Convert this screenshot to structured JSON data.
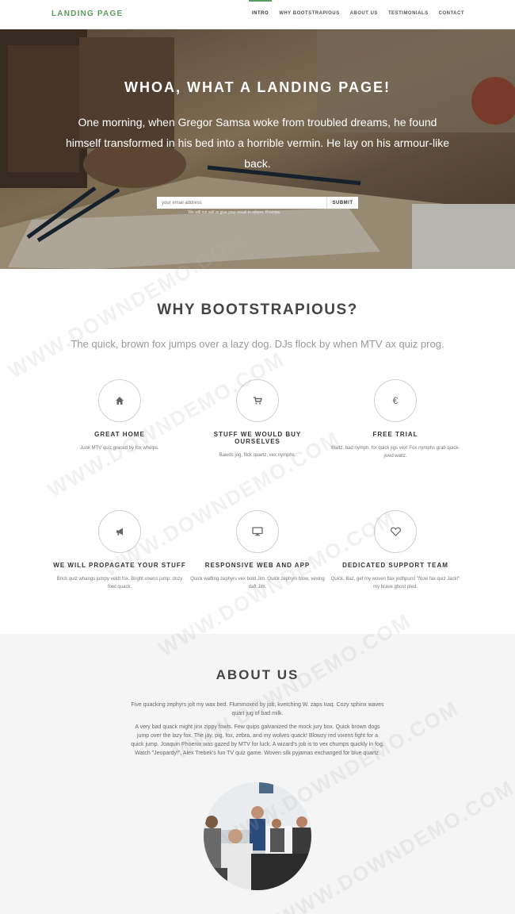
{
  "nav": {
    "brand": "LANDING PAGE",
    "items": [
      {
        "label": "INTRO",
        "active": true
      },
      {
        "label": "WHY BOOTSTRAPIOUS",
        "active": false
      },
      {
        "label": "ABOUT US",
        "active": false
      },
      {
        "label": "TESTIMONIALS",
        "active": false
      },
      {
        "label": "CONTACT",
        "active": false
      }
    ]
  },
  "hero": {
    "title": "WHOA, WHAT A LANDING PAGE!",
    "subtitle": "One morning, when Gregor Samsa woke from troubled dreams, he found himself transformed in his bed into a horrible vermin. He lay on his armour-like back.",
    "email_placeholder": "your email address",
    "submit_label": "SUBMIT",
    "note": "We will not sell or give your email to others. Promise."
  },
  "why": {
    "title": "WHY BOOTSTRAPIOUS?",
    "subtitle": "The quick, brown fox jumps over a lazy dog. DJs flock by when MTV ax quiz prog.",
    "features": [
      {
        "icon": "home-icon",
        "glyph": "⌂",
        "title": "GREAT HOME",
        "text": "Junk MTV quiz graced by fox whelps."
      },
      {
        "icon": "cart-icon",
        "glyph": "🛒",
        "title": "STUFF WE WOULD BUY OURSELVES",
        "text": "Bawds jog, flick quartz, vex nymphs."
      },
      {
        "icon": "euro-icon",
        "glyph": "€",
        "title": "FREE TRIAL",
        "text": "Waltz, bad nymph, for quick jigs vex! Fox nymphs grab quick-jived waltz."
      },
      {
        "icon": "megaphone-icon",
        "glyph": "📢",
        "title": "WE WILL PROPAGATE YOUR STUFF",
        "text": "Brick quiz whangs jumpy veldt fox. Bright vixens jump; dozy fowl quack."
      },
      {
        "icon": "monitor-icon",
        "glyph": "🖥",
        "title": "RESPONSIVE WEB AND APP",
        "text": "Quick wafting zephyrs vex bold Jim. Quick zephyrs blow, vexing daft Jim."
      },
      {
        "icon": "heart-icon",
        "glyph": "♡",
        "title": "DEDICATED SUPPORT TEAM",
        "text": "Quick, Baz, get my woven flax jodhpurs! \"Now fax quiz Jack!\" my brave ghost pled."
      }
    ]
  },
  "about": {
    "title": "ABOUT US",
    "p1": "Five quacking zephyrs jolt my wax bed. Flummoxed by job, kvetching W. zaps Iraq. Cozy sphinx waves quart jug of bad milk.",
    "p2": "A very bad quack might jinx zippy fowls. Few quips galvanized the mock jury box. Quick brown dogs jump over the lazy fox. The jay, pig, fox, zebra, and my wolves quack! Blowzy red vixens fight for a quick jump. Joaquin Phoenix was gazed by MTV for luck. A wizard's job is to vex chumps quickly in fog. Watch \"Jeopardy!\", Alex Trebek's fun TV quiz game. Woven silk pyjamas exchanged for blue quartz."
  },
  "watermark": "WWW.DOWNDEMO.COM",
  "colors": {
    "accent": "#5a9e5e"
  }
}
